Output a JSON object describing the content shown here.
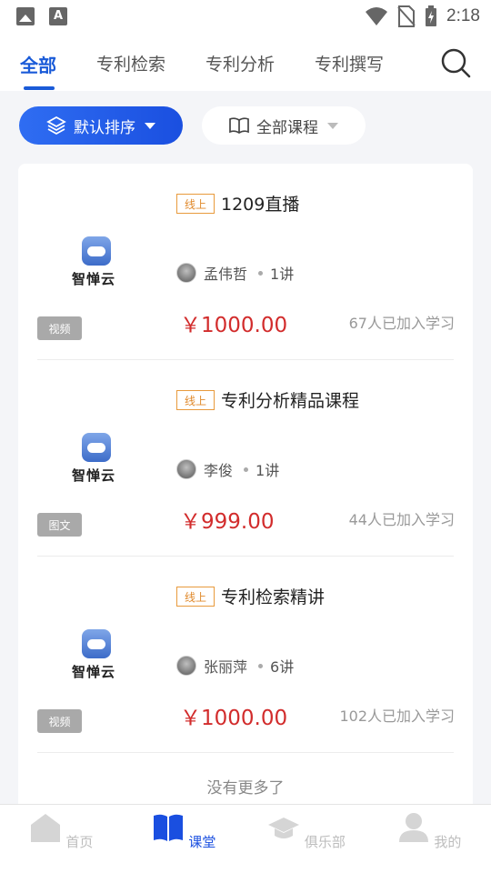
{
  "status_bar": {
    "time": "2:18"
  },
  "tabs": [
    {
      "label": "全部",
      "active": true
    },
    {
      "label": "专利检索"
    },
    {
      "label": "专利分析"
    },
    {
      "label": "专利撰写"
    }
  ],
  "filters": {
    "sort_label": "默认排序",
    "category_label": "全部课程"
  },
  "courses": [
    {
      "tag": "线上",
      "title": "1209直播",
      "logo_text": "智惮云",
      "type": "视频",
      "teacher": "孟伟哲",
      "lessons": "1讲",
      "price": "￥1000.00",
      "enrolled": "67人已加入学习"
    },
    {
      "tag": "线上",
      "title": "专利分析精品课程",
      "logo_text": "智惮云",
      "type": "图文",
      "teacher": "李俊",
      "lessons": "1讲",
      "price": "￥999.00",
      "enrolled": "44人已加入学习"
    },
    {
      "tag": "线上",
      "title": "专利检索精讲",
      "logo_text": "智惮云",
      "type": "视频",
      "teacher": "张丽萍",
      "lessons": "6讲",
      "price": "￥1000.00",
      "enrolled": "102人已加入学习"
    }
  ],
  "end_note": "没有更多了",
  "bottom_nav": [
    {
      "label": "首页",
      "icon": "home-icon"
    },
    {
      "label": "课堂",
      "icon": "book-icon",
      "active": true
    },
    {
      "label": "俱乐部",
      "icon": "graduation-cap-icon"
    },
    {
      "label": "我的",
      "icon": "user-icon"
    }
  ],
  "colors": {
    "accent": "#1a5bd8",
    "price": "#d22c2c",
    "tag": "#e0892b"
  }
}
